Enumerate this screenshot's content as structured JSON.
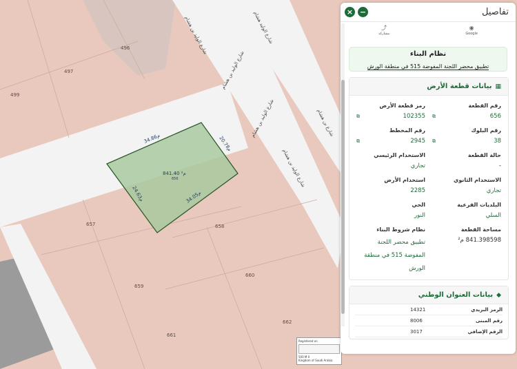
{
  "map": {
    "parcels": [
      {
        "id": "p496",
        "label": "496"
      },
      {
        "id": "p497",
        "label": "497"
      },
      {
        "id": "p499",
        "label": "499"
      },
      {
        "id": "p657",
        "label": "657"
      },
      {
        "id": "p658",
        "label": "658"
      },
      {
        "id": "p659",
        "label": "659"
      },
      {
        "id": "p660",
        "label": "660"
      },
      {
        "id": "p661",
        "label": "661"
      },
      {
        "id": "p662",
        "label": "662"
      }
    ],
    "streets": [
      {
        "id": "s1",
        "label": "شارع الوليد بن هشام"
      },
      {
        "id": "s2",
        "label": "شارع الوليد هشام"
      },
      {
        "id": "s3",
        "label": "شارع الوليد بن هشام"
      },
      {
        "id": "s4",
        "label": "شارع الوليد بن هشام"
      },
      {
        "id": "s5",
        "label": "شارع الوليد بن هشام"
      },
      {
        "id": "s6",
        "label": "شارع بن هشام"
      }
    ],
    "selected_parcel": {
      "number": "656",
      "area_label": "841.40 م²",
      "fill": "#a8c9a0",
      "stroke": "#2e5a2e"
    },
    "dimensions": [
      {
        "id": "d1",
        "label": "34.86م"
      },
      {
        "id": "d2",
        "label": "20.78م"
      },
      {
        "id": "d3",
        "label": "24.63م"
      },
      {
        "id": "d4",
        "label": "34.05م"
      }
    ],
    "scalebox": {
      "line1": "Registered on",
      "line2": "500 M 0",
      "line3": "Kingdom of Saudi Arabia"
    }
  },
  "panel": {
    "title": "تفاصيل",
    "share_items": [
      {
        "label": "Google",
        "icon": "google-icon"
      },
      {
        "label": "مشاركة",
        "icon": "share-icon"
      }
    ],
    "building_system": {
      "title": "نظام البناء",
      "value": "تطبيق محضر اللجنة المفوضة 515 في منطقة الورش"
    },
    "land_section": {
      "title": "بيانات قطعة الأرض",
      "icon": "map-icon",
      "fields": [
        {
          "label": "رقم القطعة",
          "value": "656"
        },
        {
          "label": "رمز قطعة الأرض",
          "value": "102355"
        },
        {
          "label": "رقم البلوك",
          "value": "38"
        },
        {
          "label": "رقم المخطط",
          "value": "2945"
        },
        {
          "label": "حالة القطعة",
          "value": "-"
        },
        {
          "label": "الاستخدام الرئيسي",
          "value": "تجاري"
        },
        {
          "label": "الاستخدام الثانوي",
          "value": "تجاري"
        },
        {
          "label": "استخدام الأرض",
          "value": "2285"
        },
        {
          "label": "البلديات الفرعية",
          "value": "السلي"
        },
        {
          "label": "الحي",
          "value": "النور"
        },
        {
          "label": "مساحة القطعة",
          "value": "841.398598 م²"
        },
        {
          "label": "نظام شروط البناء",
          "value": "تطبيق محضر اللجنة المفوضة 515 في منطقة الورش"
        }
      ]
    },
    "address_section": {
      "title": "بيانات العنوان الوطني",
      "icon": "tag-icon",
      "rows": [
        {
          "label": "الرمز البريدي",
          "value": "14321"
        },
        {
          "label": "رقم المبنى",
          "value": "8006"
        },
        {
          "label": "الرقم الإضافي",
          "value": "3017"
        }
      ]
    }
  },
  "colors": {
    "accent": "#1e6b3a",
    "map_parcel": "#e9c9bd",
    "map_road": "#f2f2f2",
    "selected_fill": "#a8c9a0"
  }
}
